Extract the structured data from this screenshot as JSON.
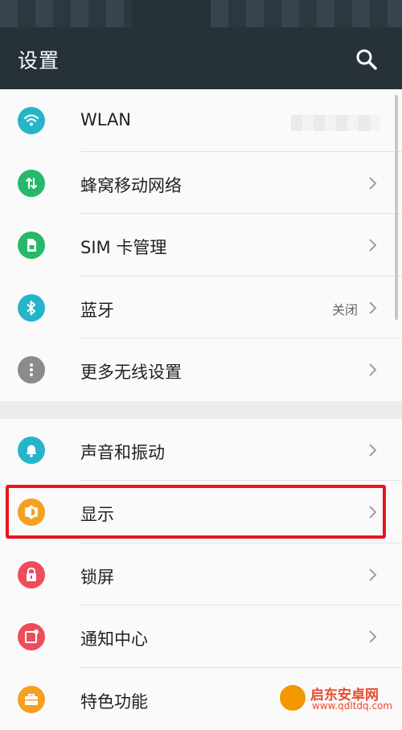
{
  "header": {
    "title": "设置"
  },
  "settings": [
    {
      "label": "WLAN",
      "value": "",
      "icon": "wifi-icon",
      "color": "#26b5c8"
    },
    {
      "label": "蜂窝移动网络",
      "value": "",
      "icon": "cellular-data-icon",
      "color": "#28b86a"
    },
    {
      "label": "SIM 卡管理",
      "value": "",
      "icon": "sim-card-icon",
      "color": "#28b86a"
    },
    {
      "label": "蓝牙",
      "value": "关闭",
      "icon": "bluetooth-icon",
      "color": "#26b5c8"
    },
    {
      "label": "更多无线设置",
      "value": "",
      "icon": "more-dots-icon",
      "color": "#8b8b8b"
    },
    {
      "label": "声音和振动",
      "value": "",
      "icon": "bell-icon",
      "color": "#26b5c8"
    },
    {
      "label": "显示",
      "value": "",
      "icon": "display-brightness-icon",
      "color": "#f5a020"
    },
    {
      "label": "锁屏",
      "value": "",
      "icon": "lock-icon",
      "color": "#ee4c5a"
    },
    {
      "label": "通知中心",
      "value": "",
      "icon": "notification-icon",
      "color": "#ee4c5a"
    },
    {
      "label": "特色功能",
      "value": "",
      "icon": "briefcase-icon",
      "color": "#f5a020"
    }
  ],
  "colors": {
    "header_bg": "#263238",
    "highlight": "#e8161f"
  },
  "watermark": {
    "title": "启东安卓网",
    "url": "www.qdltdq.com"
  }
}
